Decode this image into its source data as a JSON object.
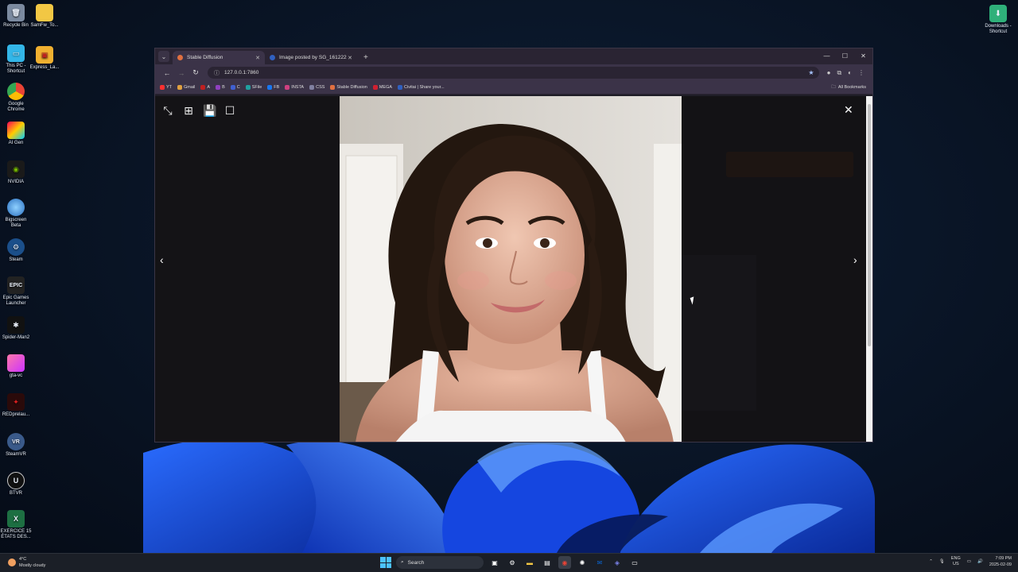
{
  "desktop": {
    "icons": [
      {
        "label": "Recycle Bin",
        "icon": "recycle-bin-icon"
      },
      {
        "label": "SamFw_To...",
        "icon": "folder-icon"
      },
      {
        "label": "This PC - Shortcut",
        "icon": "computer-icon"
      },
      {
        "label": "Express_La...",
        "icon": "app-icon"
      },
      {
        "label": "Google Chrome",
        "icon": "chrome-icon"
      },
      {
        "label": "AI Gen",
        "icon": "butterfly-icon"
      },
      {
        "label": "NVIDIA",
        "icon": "nvidia-icon"
      },
      {
        "label": "Bigscreen Beta",
        "icon": "globe-icon"
      },
      {
        "label": "Steam",
        "icon": "steam-icon"
      },
      {
        "label": "Epic Games Launcher",
        "icon": "epic-icon"
      },
      {
        "label": "Spider-Man2",
        "icon": "spider-icon"
      },
      {
        "label": "gta-vc",
        "icon": "game-icon"
      },
      {
        "label": "REDprelau...",
        "icon": "red-icon"
      },
      {
        "label": "SteamVR",
        "icon": "vr-icon"
      },
      {
        "label": "BTVR",
        "icon": "unreal-icon"
      },
      {
        "label": "EXERCICE 15 ÉTATS DES...",
        "icon": "excel-icon"
      }
    ],
    "right_icon": {
      "label": "Downloads - Shortcut",
      "icon": "download-icon"
    }
  },
  "browser": {
    "tabs": [
      {
        "title": "Stable Diffusion",
        "active": true
      },
      {
        "title": "Image posted by SG_161222",
        "active": false
      }
    ],
    "tab_menu": "⌄",
    "new_tab": "+",
    "window_controls": [
      "—",
      "☐",
      "✕"
    ],
    "url": "127.0.0.1:7860",
    "nav": {
      "back": "←",
      "forward": "→",
      "reload": "↻"
    },
    "bookmarks": [
      {
        "label": "YT",
        "color": "#ff3030"
      },
      {
        "label": "Gmail",
        "color": "#e0a040"
      },
      {
        "label": "A",
        "color": "#c02020"
      },
      {
        "label": "B",
        "color": "#9040c0"
      },
      {
        "label": "C",
        "color": "#4060d0"
      },
      {
        "label": "SFile",
        "color": "#20a0a0"
      },
      {
        "label": "FB",
        "color": "#1877f2"
      },
      {
        "label": "INSTA",
        "color": "#d04080"
      },
      {
        "label": "CSS",
        "color": "#8080a0"
      },
      {
        "label": "Stable Diffusion",
        "color": "#e07040"
      },
      {
        "label": "MEGA",
        "color": "#d02030"
      },
      {
        "label": "Civitai | Share your...",
        "color": "#3060c0"
      }
    ],
    "all_bookmarks": "All Bookmarks"
  },
  "lightbox": {
    "tools": [
      "⤡",
      "⊞",
      "💾",
      "☐"
    ],
    "close": "✕",
    "prev": "‹",
    "next": "›"
  },
  "taskbar": {
    "weather_temp": "4°C",
    "weather_desc": "Mostly cloudy",
    "search_placeholder": "Search",
    "lang_top": "ENG",
    "lang_bottom": "US",
    "time": "7:09 PM",
    "date": "2025-02-09"
  }
}
